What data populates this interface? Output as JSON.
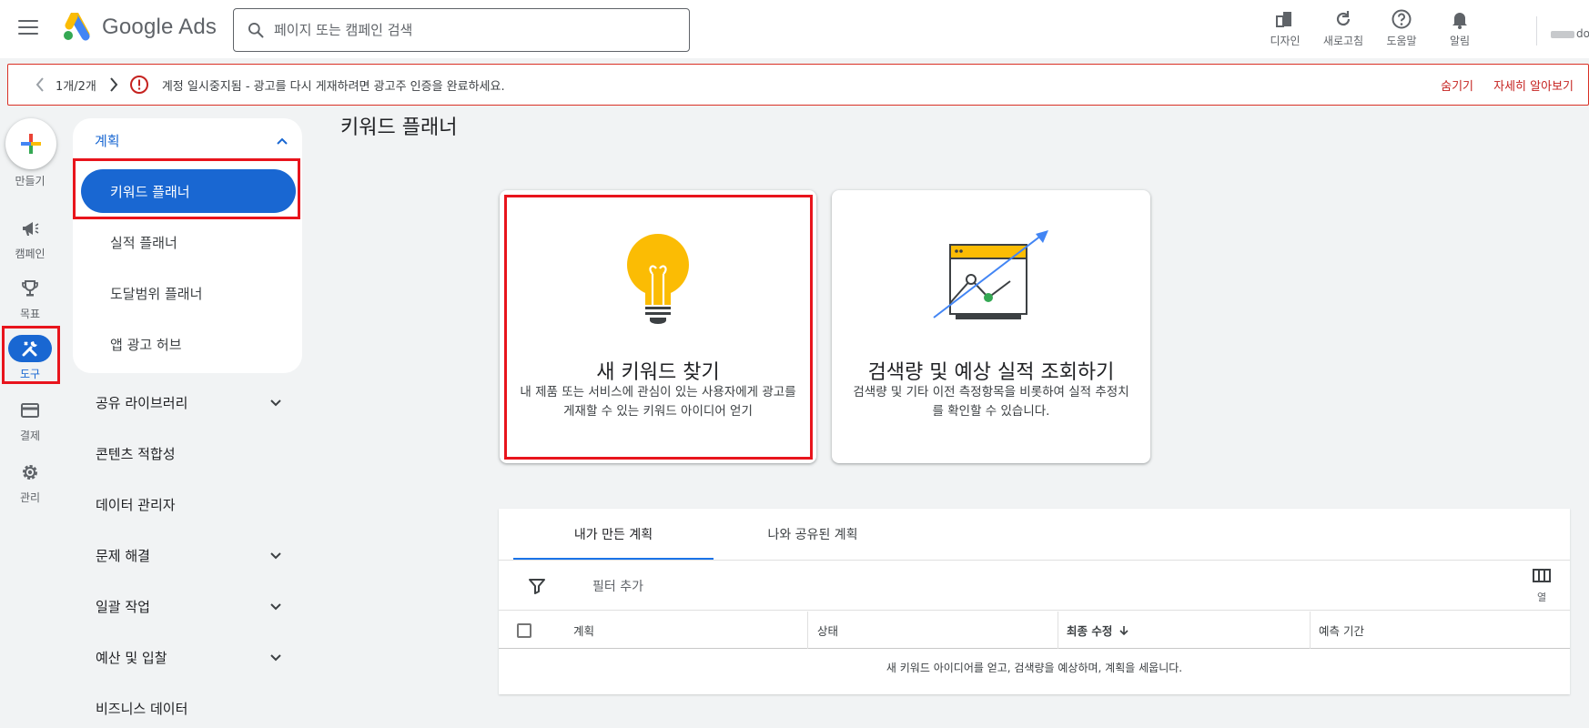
{
  "app": {
    "name": "Google Ads"
  },
  "search": {
    "placeholder": "페이지 또는 캠페인 검색"
  },
  "top_actions": [
    {
      "icon": "appearance-icon",
      "label": "디자인"
    },
    {
      "icon": "refresh-icon",
      "label": "새로고침"
    },
    {
      "icon": "help-icon",
      "label": "도움말"
    },
    {
      "icon": "bell-icon",
      "label": "알림"
    }
  ],
  "account": {
    "name_suffix": "do"
  },
  "banner": {
    "counter": "1개/2개",
    "message": "계정 일시중지됨 - 광고를 다시 게재하려면 광고주 인증을 완료하세요.",
    "hide_label": "숨기기",
    "learn_more_label": "자세히 알아보기",
    "accent_color": "#d93025"
  },
  "rail": {
    "create_label": "만들기",
    "items": [
      {
        "icon": "megaphone-icon",
        "label": "캠페인"
      },
      {
        "icon": "trophy-icon",
        "label": "목표"
      },
      {
        "icon": "tools-icon",
        "label": "도구",
        "active": true
      },
      {
        "icon": "credit-card-icon",
        "label": "결제"
      },
      {
        "icon": "gear-icon",
        "label": "관리"
      }
    ]
  },
  "nav": {
    "section_title": "계획",
    "active_item": "키워드 플래너",
    "sub_items": [
      "실적 플래너",
      "도달범위 플래너",
      "앱 광고 허브"
    ],
    "top_items": [
      {
        "label": "공유 라이브러리",
        "expandable": true
      },
      {
        "label": "콘텐츠 적합성",
        "expandable": false
      },
      {
        "label": "데이터 관리자",
        "expandable": false
      },
      {
        "label": "문제 해결",
        "expandable": true
      },
      {
        "label": "일괄 작업",
        "expandable": true
      },
      {
        "label": "예산 및 입찰",
        "expandable": true
      },
      {
        "label": "비즈니스 데이터",
        "expandable": false
      }
    ]
  },
  "main": {
    "title": "키워드 플래너",
    "cards": [
      {
        "title": "새 키워드 찾기",
        "description": "내 제품 또는 서비스에 관심이 있는 사용자에게 광고를 게재할 수 있는 키워드 아이디어 얻기"
      },
      {
        "title": "검색량 및 예상 실적 조회하기",
        "description": "검색량 및 기타 이전 측정항목을 비롯하여 실적 추정치를 확인할 수 있습니다."
      }
    ]
  },
  "plans": {
    "tabs": [
      "내가 만든 계획",
      "나와 공유된 계획"
    ],
    "filter_label": "필터 추가",
    "columns_label": "열",
    "headers": [
      "계획",
      "상태",
      "최종 수정",
      "예측 기간"
    ],
    "empty_message": "새 키워드 아이디어를 얻고, 검색량을 예상하며, 계획을 세웁니다."
  },
  "colors": {
    "primary": "#1967d2",
    "highlight": "#e8141c",
    "bulb": "#fbbc04"
  }
}
